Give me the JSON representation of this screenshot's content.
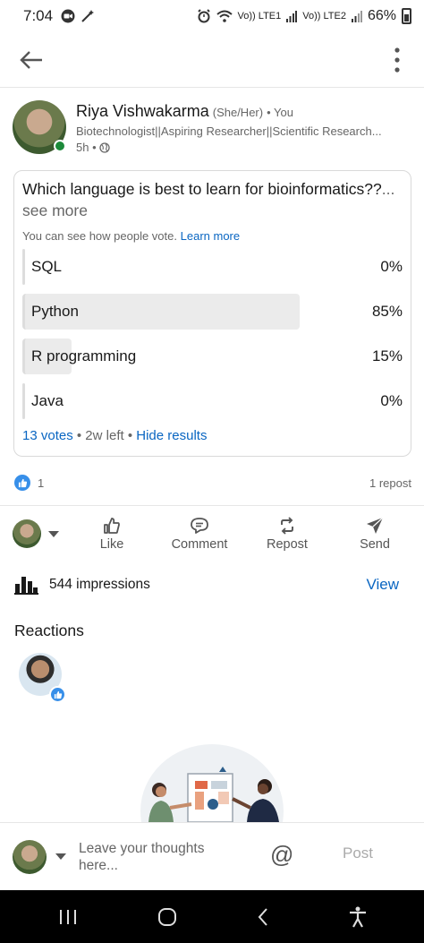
{
  "status_bar": {
    "time": "7:04",
    "network_1": "Vo)) LTE1",
    "network_2": "Vo)) LTE2",
    "battery": "66%"
  },
  "author": {
    "name": "Riya Vishwakarma",
    "pronouns": "(She/Her)",
    "relation": "• You",
    "headline": "Biotechnologist||Aspiring Researcher||Scientific Research...",
    "time": "5h •"
  },
  "poll": {
    "question": "Which language is best to learn for bioinformatics??",
    "see_more": "... see more",
    "note": "You can see how people vote.",
    "learn_more": "Learn more",
    "options": [
      {
        "label": "SQL",
        "percent_text": "0%",
        "percent": 0
      },
      {
        "label": "Python",
        "percent_text": "85%",
        "percent": 85
      },
      {
        "label": "R programming",
        "percent_text": "15%",
        "percent": 15
      },
      {
        "label": "Java",
        "percent_text": "0%",
        "percent": 0
      }
    ],
    "votes": "13 votes",
    "time_left": "• 2w left •",
    "hide_results": "Hide results"
  },
  "social": {
    "reaction_count": "1",
    "reposts": "1 repost"
  },
  "actions": {
    "like": "Like",
    "comment": "Comment",
    "repost": "Repost",
    "send": "Send"
  },
  "impressions": {
    "text": "544 impressions",
    "view": "View"
  },
  "reactions": {
    "title": "Reactions"
  },
  "comment_bar": {
    "placeholder": "Leave your thoughts here...",
    "mention": "@",
    "post": "Post"
  },
  "colors": {
    "link": "#0a66c2",
    "like_badge": "#378fe9",
    "online": "#1c8a3a",
    "poll_bar": "#ebebeb"
  }
}
